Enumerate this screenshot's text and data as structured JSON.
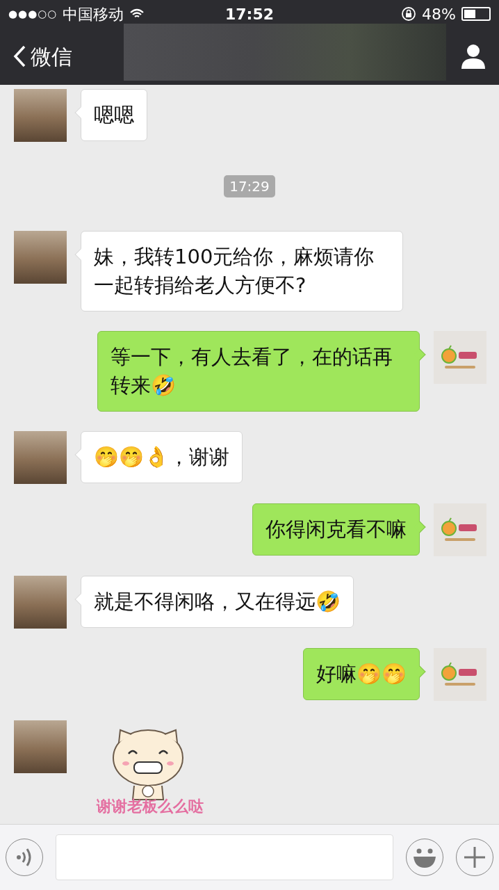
{
  "status_bar": {
    "signal_dots": "●●●○○",
    "carrier": "中国移动",
    "time": "17:52",
    "battery": "48%"
  },
  "nav": {
    "back_label": "微信"
  },
  "messages": [
    {
      "kind": "incoming_text",
      "text": "嗯嗯"
    },
    {
      "kind": "time",
      "text": "17:29"
    },
    {
      "kind": "incoming_text",
      "text": "妹，我转100元给你，麻烦请你一起转捐给老人方便不?"
    },
    {
      "kind": "outgoing_text",
      "text": "等一下，有人去看了，在的话再转来🤣"
    },
    {
      "kind": "incoming_text",
      "text": "🤭🤭👌，谢谢"
    },
    {
      "kind": "outgoing_text",
      "text": "你得闲克看不嘛"
    },
    {
      "kind": "incoming_text",
      "text": "就是不得闲咯，又在得远🤣"
    },
    {
      "kind": "outgoing_text",
      "text": "好嘛🤭🤭"
    },
    {
      "kind": "incoming_sticker",
      "caption": "谢谢老板么么哒"
    }
  ]
}
